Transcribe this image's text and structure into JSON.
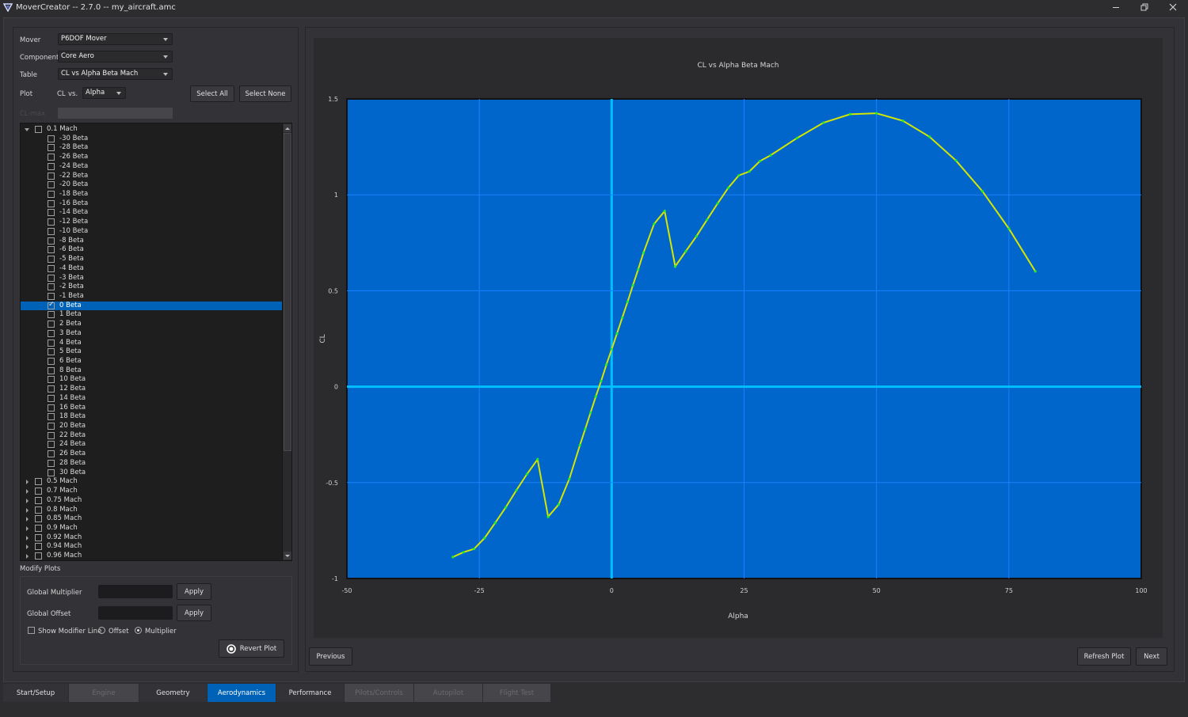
{
  "window": {
    "title": "MoverCreator -- 2.7.0 -- my_aircraft.amc",
    "icons": [
      "app-logo-icon",
      "minimize-icon",
      "restore-icon",
      "close-icon"
    ]
  },
  "controls": {
    "mover_label": "Mover",
    "mover_value": "P6DOF Mover",
    "component_label": "Component",
    "component_value": "Core Aero",
    "table_label": "Table",
    "table_value": "CL vs Alpha Beta Mach",
    "plot_label": "Plot",
    "plot_dependent": "CL",
    "plot_vs": "vs.",
    "plot_independent": "Alpha",
    "select_all": "Select All",
    "select_none": "Select None",
    "disabled_field_label": "CL-max"
  },
  "tree": {
    "groups": [
      {
        "label": "0.1 Mach",
        "expanded": true,
        "checked": false,
        "children": [
          {
            "label": "-30 Beta",
            "checked": false
          },
          {
            "label": "-28 Beta",
            "checked": false
          },
          {
            "label": "-26 Beta",
            "checked": false
          },
          {
            "label": "-24 Beta",
            "checked": false
          },
          {
            "label": "-22 Beta",
            "checked": false
          },
          {
            "label": "-20 Beta",
            "checked": false
          },
          {
            "label": "-18 Beta",
            "checked": false
          },
          {
            "label": "-16 Beta",
            "checked": false
          },
          {
            "label": "-14 Beta",
            "checked": false
          },
          {
            "label": "-12 Beta",
            "checked": false
          },
          {
            "label": "-10 Beta",
            "checked": false
          },
          {
            "label": "-8 Beta",
            "checked": false
          },
          {
            "label": "-6 Beta",
            "checked": false
          },
          {
            "label": "-5 Beta",
            "checked": false
          },
          {
            "label": "-4 Beta",
            "checked": false
          },
          {
            "label": "-3 Beta",
            "checked": false
          },
          {
            "label": "-2 Beta",
            "checked": false
          },
          {
            "label": "-1 Beta",
            "checked": false
          },
          {
            "label": "0 Beta",
            "checked": true,
            "selected": true
          },
          {
            "label": "1 Beta",
            "checked": false
          },
          {
            "label": "2 Beta",
            "checked": false
          },
          {
            "label": "3 Beta",
            "checked": false
          },
          {
            "label": "4 Beta",
            "checked": false
          },
          {
            "label": "5 Beta",
            "checked": false
          },
          {
            "label": "6 Beta",
            "checked": false
          },
          {
            "label": "8 Beta",
            "checked": false
          },
          {
            "label": "10 Beta",
            "checked": false
          },
          {
            "label": "12 Beta",
            "checked": false
          },
          {
            "label": "14 Beta",
            "checked": false
          },
          {
            "label": "16 Beta",
            "checked": false
          },
          {
            "label": "18 Beta",
            "checked": false
          },
          {
            "label": "20 Beta",
            "checked": false
          },
          {
            "label": "22 Beta",
            "checked": false
          },
          {
            "label": "24 Beta",
            "checked": false
          },
          {
            "label": "26 Beta",
            "checked": false
          },
          {
            "label": "28 Beta",
            "checked": false
          },
          {
            "label": "30 Beta",
            "checked": false
          }
        ]
      },
      {
        "label": "0.5 Mach",
        "expanded": false,
        "checked": false
      },
      {
        "label": "0.7 Mach",
        "expanded": false,
        "checked": false
      },
      {
        "label": "0.75 Mach",
        "expanded": false,
        "checked": false
      },
      {
        "label": "0.8 Mach",
        "expanded": false,
        "checked": false
      },
      {
        "label": "0.85 Mach",
        "expanded": false,
        "checked": false
      },
      {
        "label": "0.9 Mach",
        "expanded": false,
        "checked": false
      },
      {
        "label": "0.92 Mach",
        "expanded": false,
        "checked": false
      },
      {
        "label": "0.94 Mach",
        "expanded": false,
        "checked": false
      },
      {
        "label": "0.96 Mach",
        "expanded": false,
        "checked": false
      }
    ]
  },
  "modify": {
    "title": "Modify Plots",
    "global_multiplier_label": "Global Multiplier",
    "global_multiplier_value": "",
    "global_offset_label": "Global Offset",
    "global_offset_value": "",
    "apply": "Apply",
    "show_modifier_line": "Show Modifier Line",
    "show_modifier_checked": false,
    "offset_radio": "Offset",
    "multiplier_radio": "Multiplier",
    "selected_mode": "Multiplier",
    "revert_plot": "Revert Plot"
  },
  "nav": {
    "previous": "Previous",
    "refresh_plot": "Refresh Plot",
    "next": "Next"
  },
  "tabs": [
    {
      "label": "Start/Setup",
      "state": "enabled"
    },
    {
      "label": "Engine",
      "state": "disabled"
    },
    {
      "label": "Geometry",
      "state": "enabled"
    },
    {
      "label": "Aerodynamics",
      "state": "active"
    },
    {
      "label": "Performance",
      "state": "enabled"
    },
    {
      "label": "Pilots/Controls",
      "state": "disabled"
    },
    {
      "label": "Autopilot",
      "state": "disabled"
    },
    {
      "label": "Flight Test",
      "state": "disabled"
    }
  ],
  "colors": {
    "accent": "#0062b6",
    "plot_background": "#0066cc",
    "grid": "#1a80ff",
    "axis_zero_line": "#00c0ff",
    "series_line": "#d4e600",
    "series_point": "#22ee22"
  },
  "chart_data": {
    "type": "line",
    "title": "CL vs Alpha Beta Mach",
    "xlabel": "Alpha",
    "ylabel": "CL",
    "xlim": [
      -50,
      100
    ],
    "ylim": [
      -1,
      1.5
    ],
    "xticks": [
      -50,
      -25,
      0,
      25,
      50,
      75,
      100
    ],
    "yticks": [
      -1,
      -0.5,
      0,
      0.5,
      1,
      1.5
    ],
    "grid": true,
    "series": [
      {
        "name": "0.1 Mach, 0 Beta",
        "x": [
          -30,
          -28,
          -26,
          -24,
          -22,
          -20,
          -18,
          -16,
          -14,
          -12,
          -10,
          -8,
          -6,
          -5,
          -4,
          -3,
          -2,
          -1,
          0,
          1,
          2,
          3,
          4,
          5,
          6,
          8,
          10,
          12,
          14,
          16,
          18,
          20,
          22,
          24,
          26,
          28,
          30,
          35,
          40,
          45,
          50,
          55,
          60,
          65,
          70,
          75,
          80
        ],
        "y": [
          -0.888,
          -0.863,
          -0.846,
          -0.789,
          -0.71,
          -0.629,
          -0.54,
          -0.456,
          -0.379,
          -0.678,
          -0.614,
          -0.481,
          -0.305,
          -0.221,
          -0.136,
          -0.051,
          0.029,
          0.115,
          0.195,
          0.277,
          0.36,
          0.442,
          0.528,
          0.611,
          0.698,
          0.848,
          0.915,
          0.627,
          0.706,
          0.784,
          0.87,
          0.955,
          1.036,
          1.101,
          1.122,
          1.176,
          1.206,
          1.296,
          1.376,
          1.42,
          1.425,
          1.386,
          1.303,
          1.179,
          1.019,
          0.824,
          0.601
        ]
      }
    ]
  }
}
